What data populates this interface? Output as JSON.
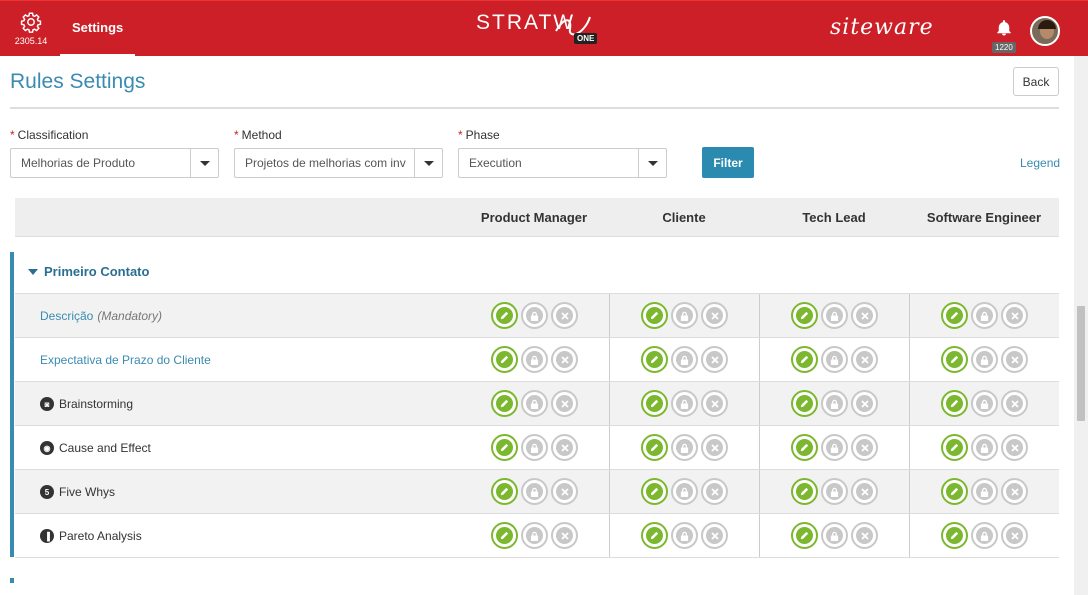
{
  "topbar": {
    "version": "2305.14",
    "settings_tab": "Settings",
    "logo_main": "STRATW",
    "logo_badge": "ONE",
    "brand_right": "siteware",
    "notification_count": "1220",
    "colors": {
      "bar": "#cc1f27"
    }
  },
  "header": {
    "title": "Rules Settings",
    "back_label": "Back"
  },
  "filters": {
    "classification": {
      "label": "Classification",
      "value": "Melhorias de Produto"
    },
    "method": {
      "label": "Method",
      "value": "Projetos de melhorias com inv"
    },
    "phase": {
      "label": "Phase",
      "value": "Execution"
    },
    "required_mark": "*",
    "filter_button": "Filter",
    "legend_link": "Legend"
  },
  "table": {
    "columns": [
      "Product Manager",
      "Cliente",
      "Tech Lead",
      "Software Engineer"
    ],
    "group": "Primeiro Contato",
    "rows": [
      {
        "label": "Descrição",
        "note": "(Mandatory)",
        "kind": "link",
        "icon": ""
      },
      {
        "label": "Expectativa de Prazo do Cliente",
        "note": "",
        "kind": "link",
        "icon": ""
      },
      {
        "label": "Brainstorming",
        "note": "",
        "kind": "tool",
        "icon": "brainstorm-icon"
      },
      {
        "label": "Cause and Effect",
        "note": "",
        "kind": "tool",
        "icon": "fishbone-icon"
      },
      {
        "label": "Five Whys",
        "note": "",
        "kind": "tool",
        "icon": "five-whys-icon"
      },
      {
        "label": "Pareto Analysis",
        "note": "",
        "kind": "tool",
        "icon": "pareto-icon"
      }
    ],
    "permission_icons": [
      "edit-icon",
      "lock-icon",
      "close-icon"
    ],
    "colors": {
      "edit": "#7cb82f",
      "disabled": "#c8c8c8",
      "accent": "#3a8bb1"
    }
  }
}
